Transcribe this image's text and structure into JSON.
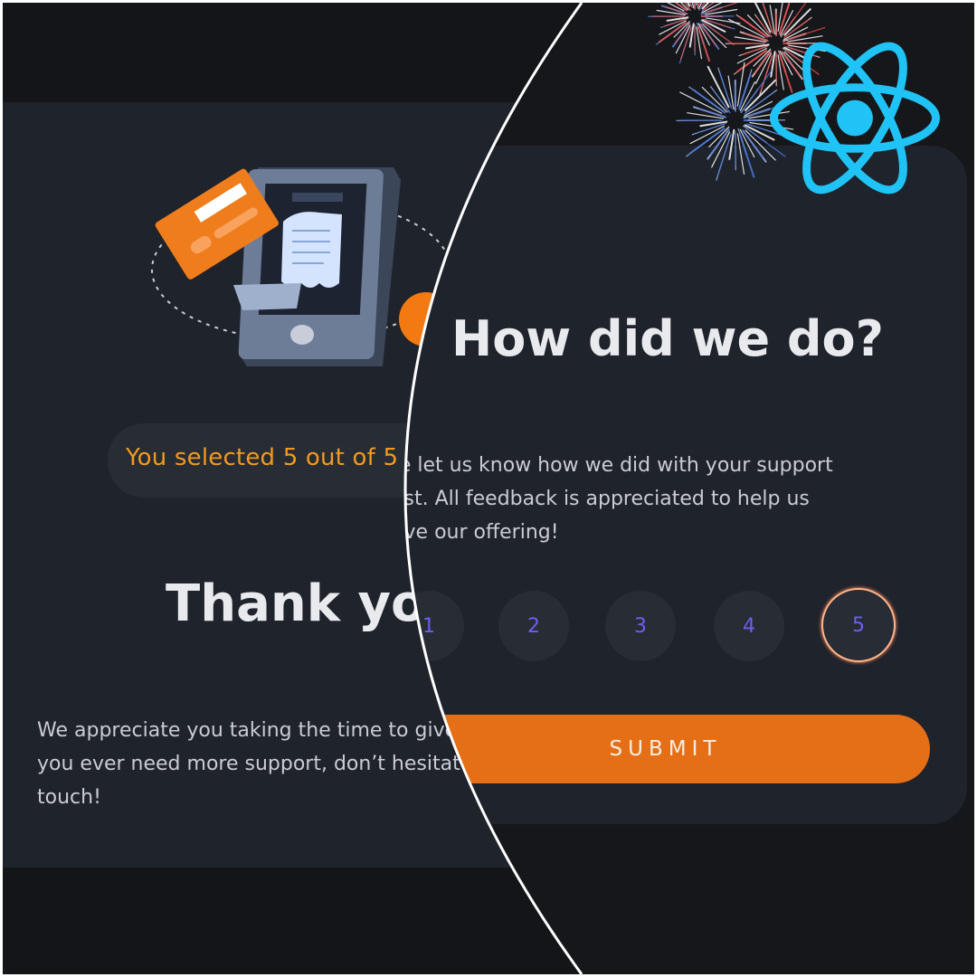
{
  "thank_you": {
    "rating_message": "You selected 5 out of 5",
    "title": "Thank you!",
    "body": "We appreciate you taking the time to give a rating. If you ever need more support, don’t hesitate to get in touch!"
  },
  "rating_card": {
    "title": "How did we do?",
    "body": "Please let us know how we did with your support request. All feedback is appreciated to help us improve our offering!",
    "options": [
      "1",
      "2",
      "3",
      "4",
      "5"
    ],
    "selected": "5",
    "submit_label": "SUBMIT"
  },
  "colors": {
    "background": "#141518",
    "card": "#1f232c",
    "accent_orange": "#e56f17",
    "rating_text": "#f39a1c",
    "option_number": "#6b5ff0",
    "react_blue": "#1fc3f5"
  },
  "icons": [
    "receipt-phone-illustration-icon",
    "credit-card-icon",
    "fireworks-icon",
    "react-logo-icon"
  ]
}
